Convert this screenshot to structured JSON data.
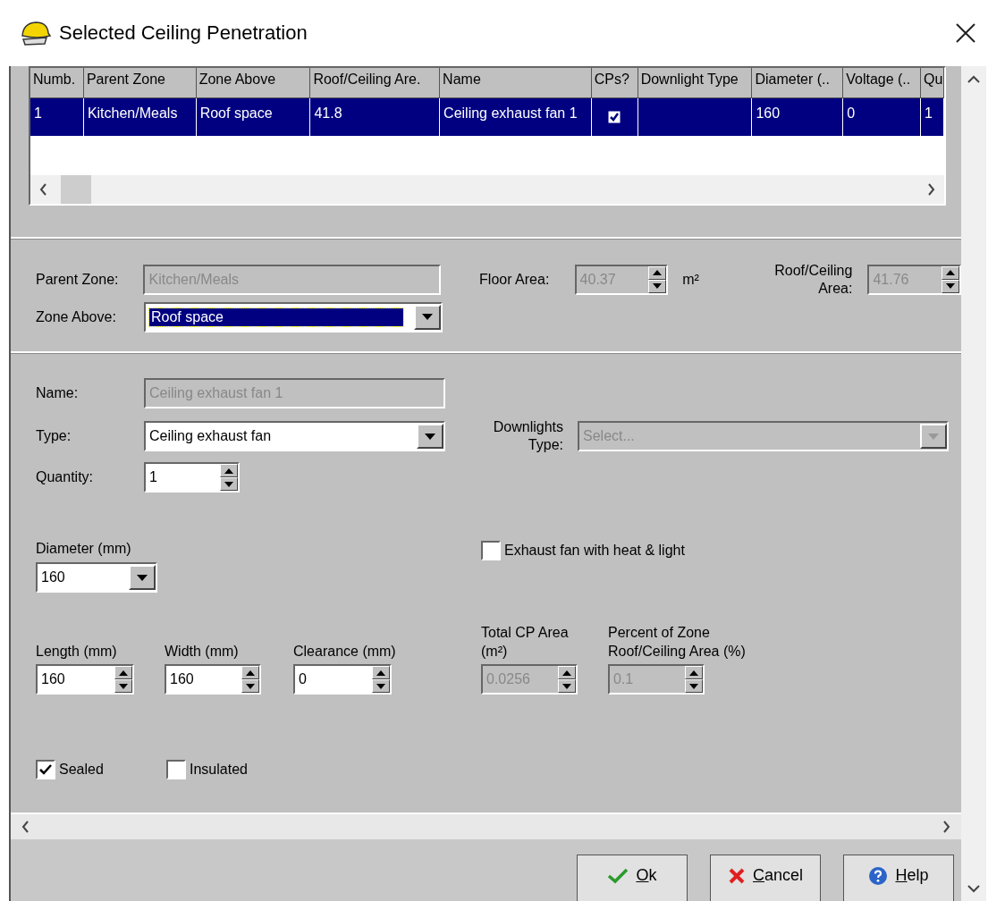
{
  "window": {
    "title": "Selected Ceiling Penetration"
  },
  "table": {
    "columns": [
      "Numb.",
      "Parent Zone",
      "Zone Above",
      "Roof/Ceiling Are.",
      "Name",
      "CPs?",
      "Downlight Type",
      "Diameter (..",
      "Voltage (..",
      "Qu"
    ],
    "rows": [
      {
        "selected": true,
        "cells": [
          {
            "kind": "text",
            "text": "1"
          },
          {
            "kind": "text",
            "text": "Kitchen/Meals"
          },
          {
            "kind": "text",
            "text": "Roof space"
          },
          {
            "kind": "text",
            "text": "41.8"
          },
          {
            "kind": "text",
            "text": "Ceiling exhaust fan 1"
          },
          {
            "kind": "checkbox",
            "checked": true
          },
          {
            "kind": "text"
          },
          {
            "kind": "text",
            "text": "160"
          },
          {
            "kind": "text",
            "text": "0"
          },
          {
            "kind": "text",
            "text": "1"
          }
        ]
      }
    ]
  },
  "zone": {
    "parent_zone": {
      "label": "Parent Zone:",
      "kind": "text",
      "value": "Kitchen/Meals",
      "disabled": true
    },
    "zone_above": {
      "label": "Zone Above:",
      "kind": "combo",
      "value": "Roof space",
      "disabled": false,
      "focused": true
    },
    "floor_area": {
      "label": "Floor Area:",
      "kind": "spin",
      "value": "40.37",
      "unit": "m²",
      "disabled": true
    },
    "roof_ceiling_area": {
      "label": "Roof/Ceiling Area:",
      "kind": "spin",
      "value": "41.76",
      "disabled": true
    }
  },
  "penetration": {
    "name": {
      "label": "Name:",
      "kind": "text",
      "value": "Ceiling exhaust fan 1",
      "disabled": true
    },
    "type": {
      "label": "Type:",
      "kind": "combo",
      "value": "Ceiling exhaust fan",
      "disabled": false
    },
    "downlights_type": {
      "label": "Downlights Type:",
      "kind": "combo",
      "placeholder": "Select...",
      "disabled": true
    },
    "quantity": {
      "label": "Quantity:",
      "kind": "spin",
      "value": "1",
      "disabled": false
    },
    "diameter": {
      "label": "Diameter (mm)",
      "kind": "combo",
      "value": "160",
      "disabled": false
    },
    "heat_light": {
      "label": "Exhaust fan with heat & light",
      "checked": false
    },
    "length": {
      "label": "Length (mm)",
      "kind": "spin",
      "value": "160",
      "disabled": false
    },
    "width": {
      "label": "Width (mm)",
      "kind": "spin",
      "value": "160",
      "disabled": false
    },
    "clearance": {
      "label": "Clearance (mm)",
      "kind": "spin",
      "value": "0",
      "disabled": false
    },
    "total_cp_area": {
      "label": "Total CP Area (m²)",
      "kind": "spin",
      "value": "0.0256",
      "disabled": true
    },
    "percent_of_zone": {
      "label": "Percent of Zone Roof/Ceiling Area (%)",
      "kind": "spin",
      "value": "0.1",
      "disabled": true
    },
    "sealed": {
      "label": "Sealed",
      "checked": true
    },
    "insulated": {
      "label": "Insulated",
      "checked": false
    }
  },
  "buttons": [
    {
      "kind": "ok",
      "label": "Ok"
    },
    {
      "kind": "cancel",
      "label": "Cancel"
    },
    {
      "kind": "help",
      "label": "Help"
    }
  ]
}
